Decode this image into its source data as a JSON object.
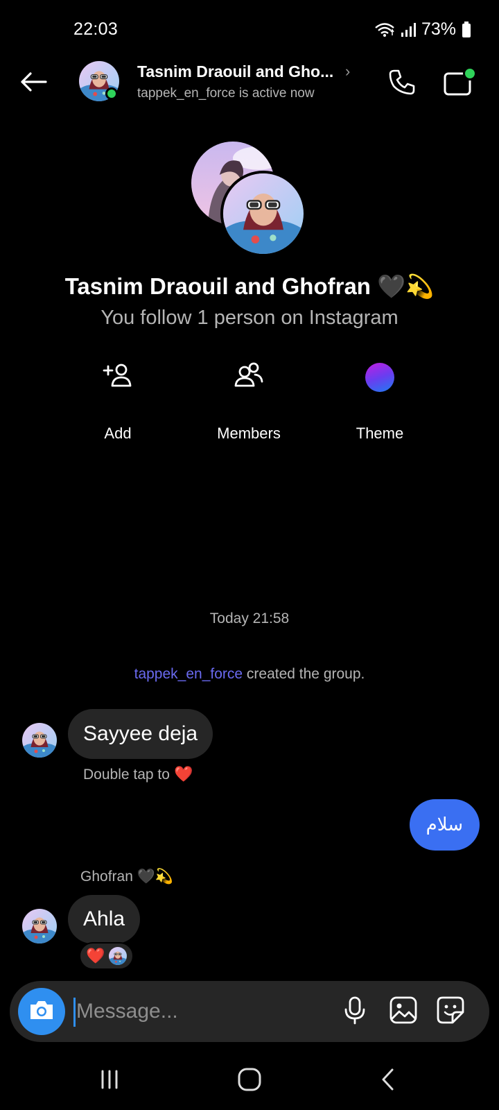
{
  "status_bar": {
    "time": "22:03",
    "battery": "73%"
  },
  "header": {
    "title": "Tasnim Draouil and Gho...",
    "chevron": "›",
    "subtitle": "tappek_en_force is active now",
    "icons": [
      "back-arrow-icon",
      "phone-icon",
      "video-camera-icon"
    ]
  },
  "profile": {
    "name": "Tasnim Draouil and Ghofran 🖤💫",
    "subtitle": "You follow 1 person on Instagram",
    "actions": [
      {
        "label": "Add",
        "icon": "add-person-icon"
      },
      {
        "label": "Members",
        "icon": "members-icon"
      },
      {
        "label": "Theme",
        "icon": "theme-gradient-dot"
      }
    ]
  },
  "conversation": {
    "timestamp": "Today 21:58",
    "system": {
      "user": "tappek_en_force",
      "text": " created the group."
    },
    "messages": [
      {
        "direction": "incoming",
        "text": "Sayyee deja",
        "hint": "Double tap to",
        "hint_emoji": "❤️"
      },
      {
        "direction": "outgoing",
        "text": "سلام"
      },
      {
        "direction": "incoming",
        "sender": "Ghofran 🖤💫",
        "text": "Ahla",
        "reaction": "❤️"
      }
    ]
  },
  "composer": {
    "placeholder": "Message...",
    "icons": [
      "camera-icon",
      "microphone-icon",
      "gallery-icon",
      "sticker-icon"
    ]
  },
  "colors": {
    "background": "#000000",
    "incoming_bubble": "#262626",
    "outgoing_bubble": "#3a6ff2",
    "camera_button": "#2f8ff0",
    "online": "#2fd35a",
    "link_user": "#6a6af0"
  }
}
